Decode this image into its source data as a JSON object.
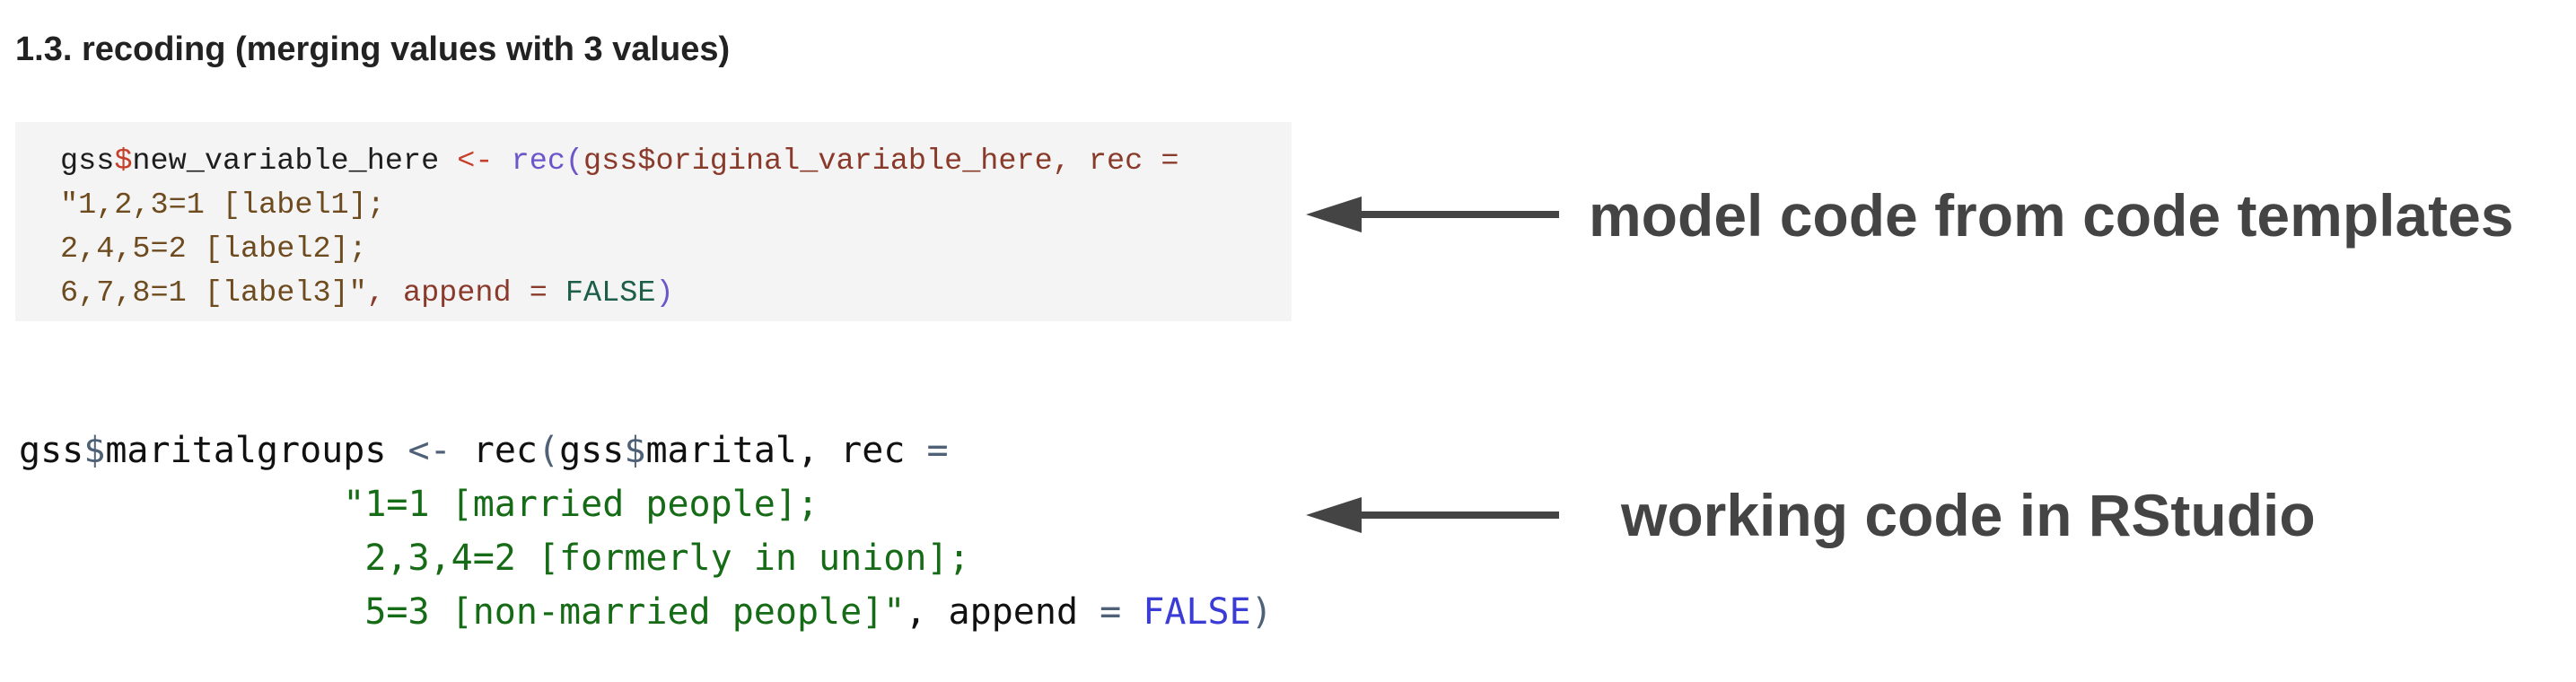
{
  "section": {
    "title": "1.3. recoding (merging values with 3 values)"
  },
  "template_code": {
    "lines": [
      [
        {
          "text": "gss",
          "kind": "plain"
        },
        {
          "text": "$",
          "kind": "dollar"
        },
        {
          "text": "new_variable_here ",
          "kind": "plain"
        },
        {
          "text": "<-",
          "kind": "op"
        },
        {
          "text": " ",
          "kind": "plain"
        },
        {
          "text": "rec(",
          "kind": "fn"
        },
        {
          "text": "gss$original_variable_here, rec =",
          "kind": "param"
        }
      ],
      [
        {
          "text": "\"1,2,3=1 [label1];",
          "kind": "str"
        }
      ],
      [
        {
          "text": "2,4,5=2 [label2];",
          "kind": "str"
        }
      ],
      [
        {
          "text": "6,7,8=1 [label3]\"",
          "kind": "str"
        },
        {
          "text": ", append = ",
          "kind": "param"
        },
        {
          "text": "FALSE",
          "kind": "const"
        },
        {
          "text": ")",
          "kind": "fn"
        }
      ]
    ]
  },
  "working_code": {
    "lines": [
      [
        {
          "text": "gss",
          "kind": "plain"
        },
        {
          "text": "$",
          "kind": "dollar"
        },
        {
          "text": "maritalgroups ",
          "kind": "plain"
        },
        {
          "text": "<-",
          "kind": "op"
        },
        {
          "text": " rec",
          "kind": "plain"
        },
        {
          "text": "(",
          "kind": "op"
        },
        {
          "text": "gss",
          "kind": "plain"
        },
        {
          "text": "$",
          "kind": "dollar"
        },
        {
          "text": "marital, rec ",
          "kind": "plain"
        },
        {
          "text": "=",
          "kind": "op"
        }
      ],
      [
        {
          "text": "               \"1=1 [married people];",
          "kind": "str"
        }
      ],
      [
        {
          "text": "                2,3,4=2 [formerly in union];",
          "kind": "str"
        }
      ],
      [
        {
          "text": "                5=3 [non-married people]\"",
          "kind": "str"
        },
        {
          "text": ", append ",
          "kind": "plain"
        },
        {
          "text": "=",
          "kind": "op"
        },
        {
          "text": " ",
          "kind": "plain"
        },
        {
          "text": "FALSE",
          "kind": "const"
        },
        {
          "text": ")",
          "kind": "op"
        }
      ]
    ]
  },
  "annotations": {
    "model_label": "model code from code templates",
    "working_label": "working code in RStudio",
    "arrow_color": "#444444"
  },
  "colors": {
    "code_block_background": "#f4f4f4",
    "string_template": "#6e4b1f",
    "string_working": "#166b16",
    "function_template": "#6d56c9",
    "constant_working": "#3b3bd6"
  }
}
